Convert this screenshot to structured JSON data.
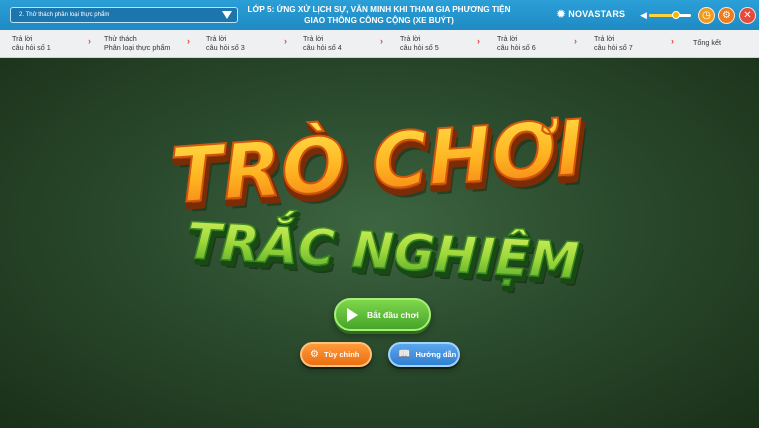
{
  "header": {
    "lesson_select": "2. Thử thách phân loại thực phẩm",
    "title_line1": "LỚP 5:  ỨNG XỬ LỊCH SỰ, VĂN MINH KHI THAM GIA PHƯƠNG TIỆN",
    "title_line2": "GIAO THÔNG CÔNG CỘNG (XE BUÝT)",
    "brand": "NOVASTARS",
    "volume_level": 0.65,
    "colors": {
      "bar": "#2b9fd7",
      "accent_orange": "#ef7c1c",
      "close_red": "#e34b3a"
    }
  },
  "steps": [
    {
      "line1": "Trả lời",
      "line2": "câu hỏi số 1"
    },
    {
      "line1": "Thử thách",
      "line2": "Phân loại thực phẩm"
    },
    {
      "line1": "Trả lời",
      "line2": "câu hỏi số 3"
    },
    {
      "line1": "Trả lời",
      "line2": "câu hỏi số 4"
    },
    {
      "line1": "Trả lời",
      "line2": "câu hỏi số 5"
    },
    {
      "line1": "Trả lời",
      "line2": "câu hỏi số 6"
    },
    {
      "line1": "Trả lời",
      "line2": "câu hỏi số 7"
    },
    {
      "line1": "Tổng kết",
      "line2": ""
    }
  ],
  "game": {
    "title_line1": "TRÒ CHƠI",
    "title_line2": "TRẮC NGHIỆM",
    "start_label": "Bắt đầu chơi",
    "settings_label": "Tùy chỉnh",
    "guide_label": "Hướng dẫn"
  },
  "icons": {
    "select_caret": "chevron-down-icon",
    "brand": "star-logo-icon",
    "volume": "speaker-icon",
    "timer": "alarm-clock-icon",
    "settings": "gear-icon",
    "close": "close-icon",
    "step_arrow": "arrow-right-icon",
    "start": "play-icon",
    "guide": "book-icon"
  }
}
